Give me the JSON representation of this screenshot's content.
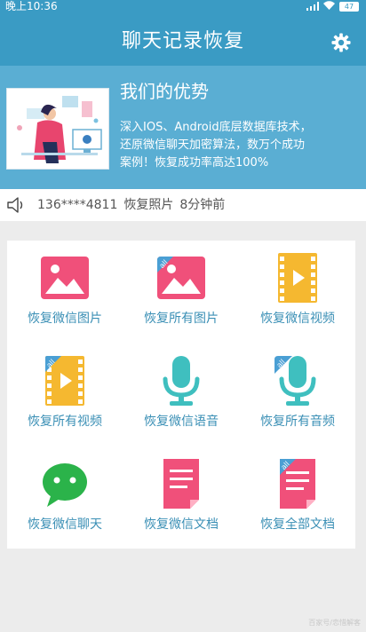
{
  "status": {
    "time": "晚上10:36",
    "battery": "47"
  },
  "header": {
    "title": "聊天记录恢复"
  },
  "banner": {
    "title": "我们的优势",
    "line1": "深入IOS、Android底层数据库技术，",
    "line2": "还原微信聊天加密算法，数万个成功",
    "line3": "案例！恢复成功率高达100%"
  },
  "ticker": {
    "phone": "136****4811",
    "action": "恢复照片",
    "time": "8分钟前"
  },
  "grid": {
    "items": [
      {
        "label": "恢复微信图片",
        "icon": "image-icon"
      },
      {
        "label": "恢复所有图片",
        "icon": "image-all-icon"
      },
      {
        "label": "恢复微信视频",
        "icon": "video-icon"
      },
      {
        "label": "恢复所有视频",
        "icon": "video-all-icon"
      },
      {
        "label": "恢复微信语音",
        "icon": "mic-icon"
      },
      {
        "label": "恢复所有音频",
        "icon": "mic-all-icon"
      },
      {
        "label": "恢复微信聊天",
        "icon": "wechat-icon"
      },
      {
        "label": "恢复微信文档",
        "icon": "document-icon"
      },
      {
        "label": "恢复全部文档",
        "icon": "document-all-icon"
      }
    ],
    "badge": "all"
  },
  "watermark": "百家号/恋惜解客",
  "colors": {
    "header": "#3a9bc4",
    "banner": "#5aaed3",
    "label": "#3a8fb5",
    "pink": "#f0507a",
    "orange": "#f5b830",
    "teal": "#3fbfbf",
    "green": "#2bb34a"
  }
}
